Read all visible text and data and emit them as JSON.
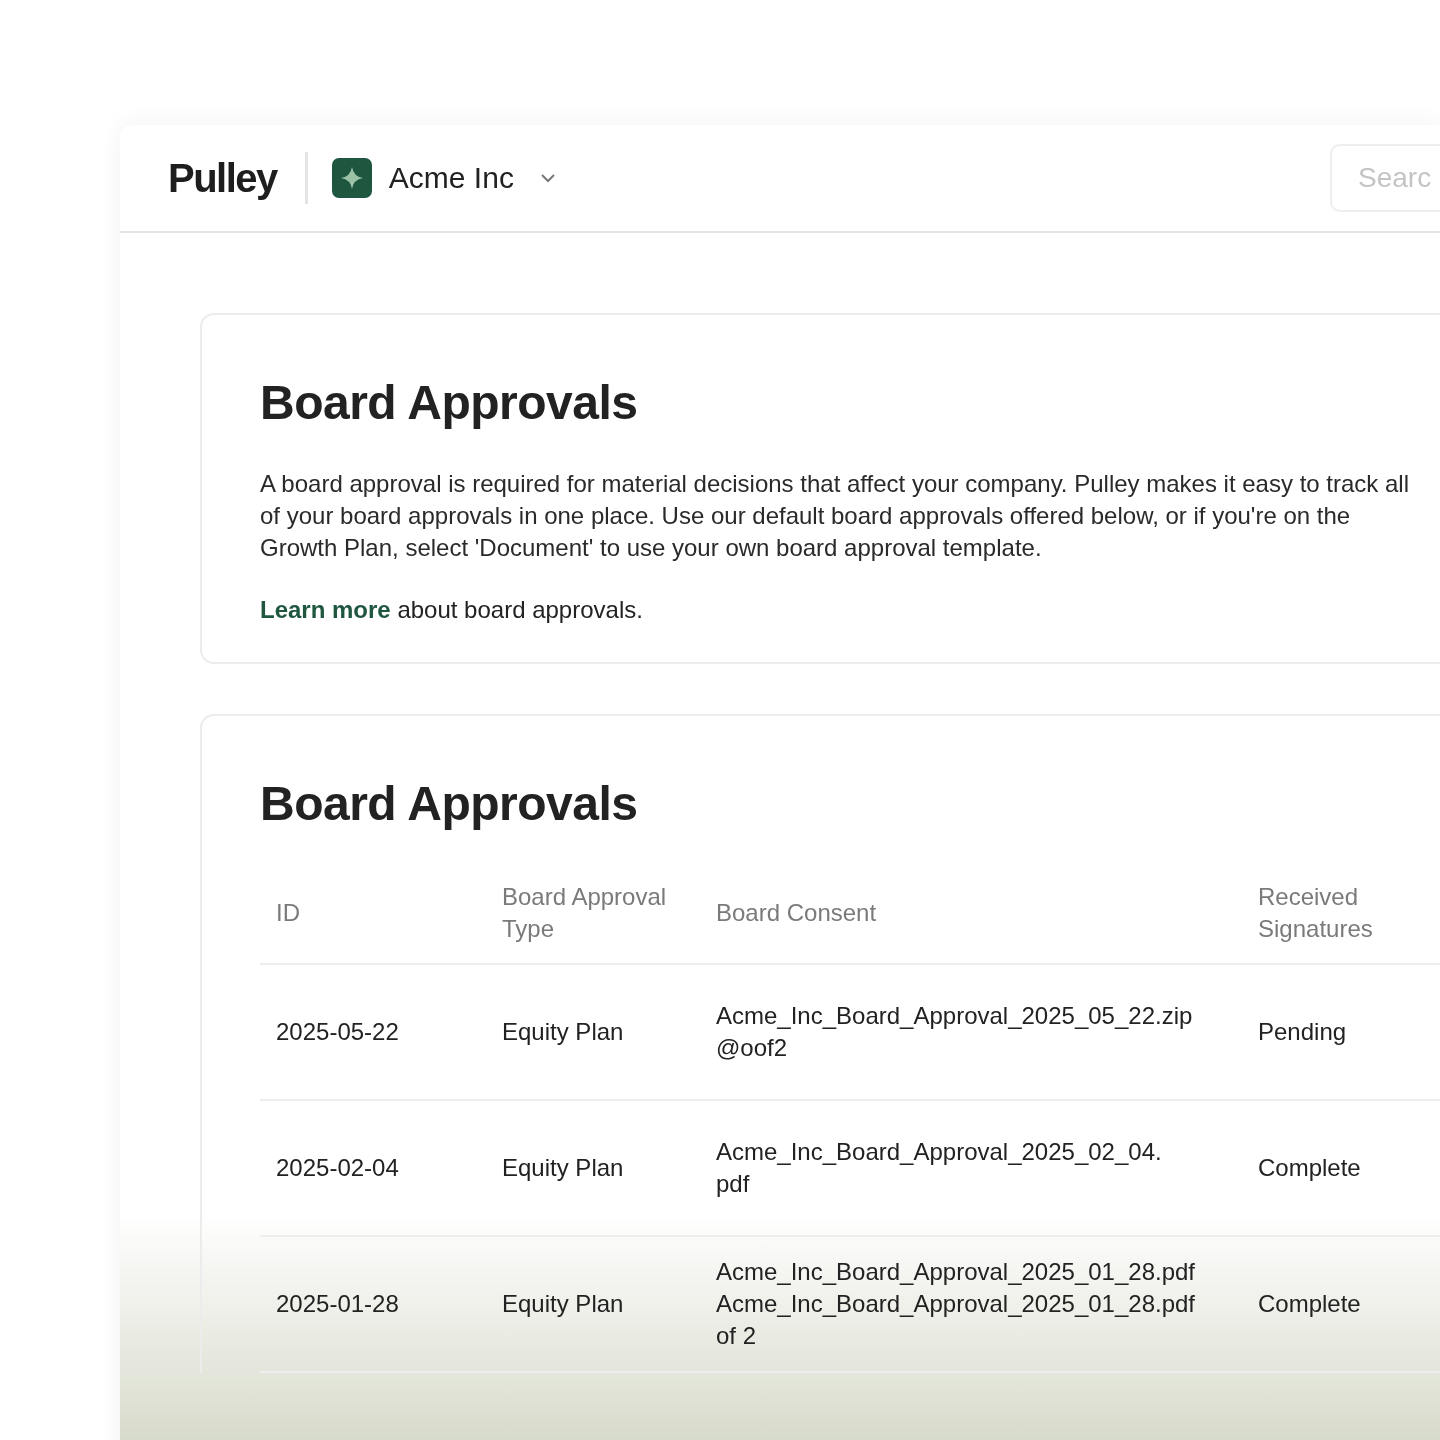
{
  "header": {
    "logo": "Pulley",
    "company": "Acme Inc",
    "search": {
      "placeholder": "Searc"
    }
  },
  "intro": {
    "title": "Board Approvals",
    "body": "A board approval is required for material decisions that affect your company. Pulley makes it easy to track all of your board approvals in one place. Use our default board approvals offered below, or if you're on the Growth Plan, select 'Document' to use your own board approval template.",
    "link": "Learn more",
    "link_tail": "about board approvals."
  },
  "approvals": {
    "title": "Board Approvals",
    "columns": [
      "ID",
      "Board Approval Type",
      "Board Consent",
      "Received Signatures"
    ],
    "rows": [
      {
        "id": "2025-05-22",
        "type": "Equity Plan",
        "consent": "Acme_Inc_Board_Approval_2025_05_22.zip\n@oof2",
        "signatures": "Pending"
      },
      {
        "id": "2025-02-04",
        "type": "Equity Plan",
        "consent": "Acme_Inc_Board_Approval_2025_02_04.\npdf",
        "signatures": "Complete"
      },
      {
        "id": "2025-01-28",
        "type": "Equity Plan",
        "consent": "Acme_Inc_Board_Approval_2025_01_28.pdf\nAcme_Inc_Board_Approval_2025_01_28.pdf\nof 2",
        "signatures": "Complete"
      }
    ]
  }
}
